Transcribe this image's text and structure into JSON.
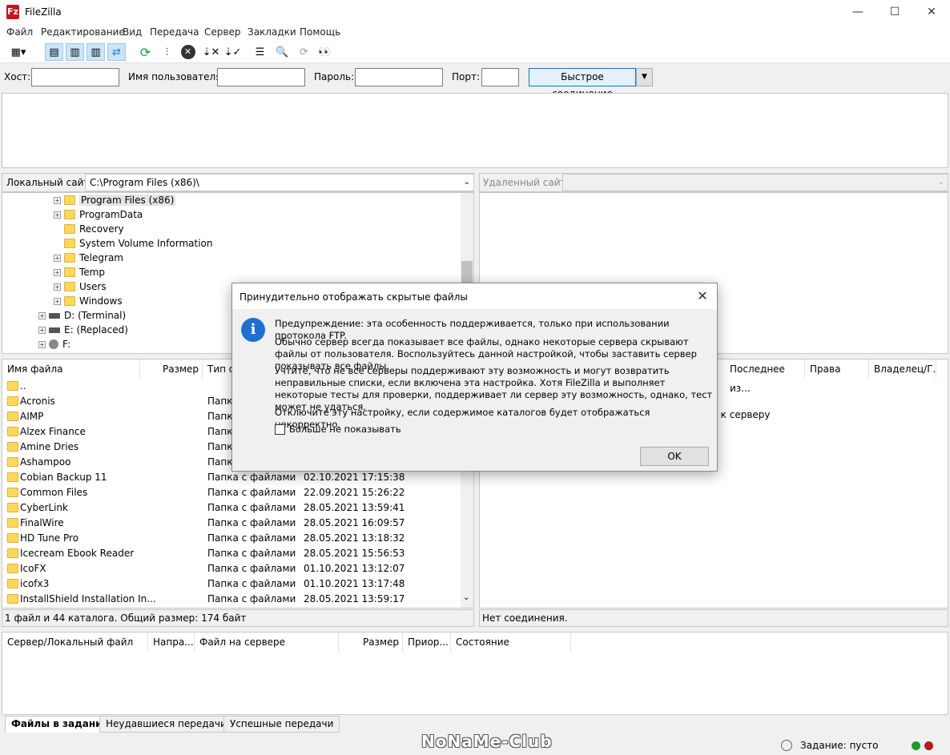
{
  "window": {
    "title": "FileZilla",
    "app_icon": "Fz"
  },
  "menu": [
    "Файл",
    "Редактирование",
    "Вид",
    "Передача",
    "Сервер",
    "Закладки",
    "Помощь"
  ],
  "quickconnect": {
    "host_label": "Хост:",
    "host_value": "",
    "user_label": "Имя пользователя:",
    "user_value": "",
    "pass_label": "Пароль:",
    "pass_value": "",
    "port_label": "Порт:",
    "port_value": "",
    "button": "Быстрое соединение"
  },
  "local": {
    "site_label": "Локальный сайт:",
    "path": "C:\\Program Files (x86)\\",
    "tree": [
      {
        "name": "Program Files (x86)",
        "expand": true,
        "selected": true
      },
      {
        "name": "ProgramData",
        "expand": true
      },
      {
        "name": "Recovery",
        "expand": false
      },
      {
        "name": "System Volume Information",
        "expand": false
      },
      {
        "name": "Telegram",
        "expand": true
      },
      {
        "name": "Temp",
        "expand": true
      },
      {
        "name": "Users",
        "expand": true
      },
      {
        "name": "Windows",
        "expand": true
      }
    ],
    "drives": [
      "D: (Terminal)",
      "E: (Replaced)",
      "F:"
    ],
    "columns": [
      "Имя файла",
      "Размер",
      "Тип файла"
    ],
    "files": [
      {
        "name": "..",
        "type": "",
        "date": ""
      },
      {
        "name": "Acronis",
        "type": "Папка с файлами",
        "date": ""
      },
      {
        "name": "AIMP",
        "type": "Папка с файлами",
        "date": ""
      },
      {
        "name": "Alzex Finance",
        "type": "Папка с файлами",
        "date": ""
      },
      {
        "name": "Amine Dries",
        "type": "Папка с файлами",
        "date": ""
      },
      {
        "name": "Ashampoo",
        "type": "Папка с файлами",
        "date": ""
      },
      {
        "name": "Cobian Backup 11",
        "type": "Папка с файлами",
        "date": "02.10.2021 17:15:38"
      },
      {
        "name": "Common Files",
        "type": "Папка с файлами",
        "date": "22.09.2021 15:26:22"
      },
      {
        "name": "CyberLink",
        "type": "Папка с файлами",
        "date": "28.05.2021 13:59:41"
      },
      {
        "name": "FinalWire",
        "type": "Папка с файлами",
        "date": "28.05.2021 16:09:57"
      },
      {
        "name": "HD Tune Pro",
        "type": "Папка с файлами",
        "date": "28.05.2021 13:18:32"
      },
      {
        "name": "Icecream Ebook Reader",
        "type": "Папка с файлами",
        "date": "28.05.2021 15:56:53"
      },
      {
        "name": "IcoFX",
        "type": "Папка с файлами",
        "date": "01.10.2021 13:12:07"
      },
      {
        "name": "icofx3",
        "type": "Папка с файлами",
        "date": "01.10.2021 13:17:48"
      },
      {
        "name": "InstallShield Installation In...",
        "type": "Папка с файлами",
        "date": "28.05.2021 13:59:17"
      }
    ],
    "status": "1 файл и 44 каталога. Общий размер: 174 байт"
  },
  "remote": {
    "site_label": "Удаленный сайт:",
    "columns": [
      "Последнее из...",
      "Права",
      "Владелец/Г..."
    ],
    "hint": "ния к серверу",
    "status": "Нет соединения."
  },
  "queue": {
    "columns": [
      "Сервер/Локальный файл",
      "Напра...",
      "Файл на сервере",
      "Размер",
      "Приор...",
      "Состояние"
    ],
    "tabs": [
      "Файлы в задании",
      "Неудавшиеся передачи",
      "Успешные передачи"
    ],
    "status": "Задание: пусто"
  },
  "watermark": "NoNaMe-Club",
  "dialog": {
    "title": "Принудительно отображать скрытые файлы",
    "p1": "Предупреждение: эта особенность поддерживается, только при использовании протокола FTP.",
    "p2": "Обычно сервер всегда показывает все файлы, однако некоторые сервера скрывают файлы от пользователя. Воспользуйтесь данной настройкой, чтобы заставить сервер показывать все файлы.",
    "p3": "Учтите, что не все серверы поддерживают эту возможность и могут возвратить неправильные списки, если включена эта настройка. Хотя FileZilla и выполняет некоторые тесты для проверки, поддерживает ли сервер эту возможность, однако, тест может не удаться.",
    "p4": "Отключите эту настройку, если содержимое каталогов будет отображаться некорректно.",
    "checkbox": "Больше не показывать",
    "checkbox_checked": false,
    "ok": "OK"
  },
  "colors": {
    "accent": "#0078d7",
    "folder": "#ffd75e",
    "info_icon": "#1e6fd0"
  }
}
